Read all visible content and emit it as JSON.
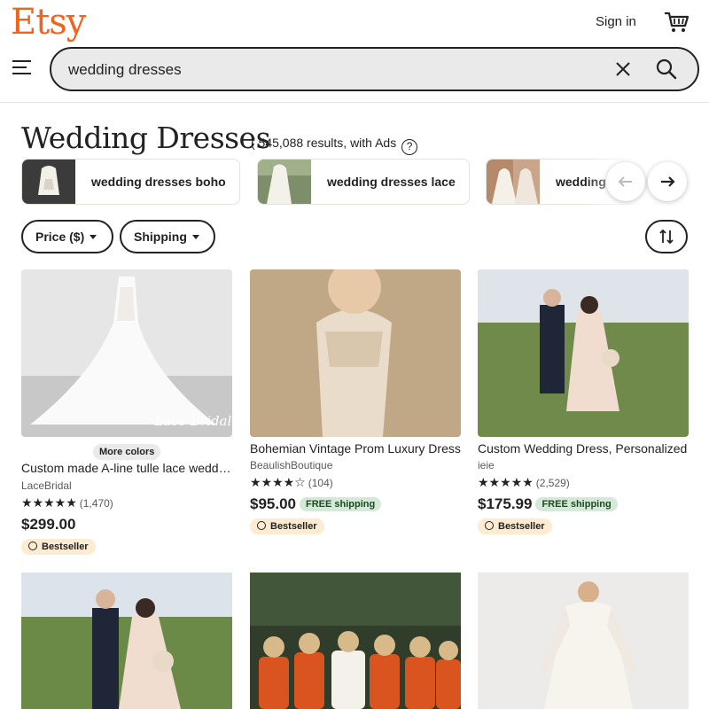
{
  "header": {
    "logo": "Etsy",
    "signin_label": "Sign in",
    "search_value": "wedding dresses",
    "brand_color": "#f1641e"
  },
  "page": {
    "title": "Wedding Dresses",
    "results_text": "( 545,088 results,",
    "ads_text": "with Ads"
  },
  "related": [
    {
      "label": "wedding dresses boho"
    },
    {
      "label": "wedding dresses lace"
    },
    {
      "label": "wedding"
    }
  ],
  "filters": {
    "price_label": "Price ($)",
    "shipping_label": "Shipping"
  },
  "listings": [
    {
      "title": "Custom made A-line tulle lace wedding dress",
      "shop": "LaceBridal",
      "stars": "★★★★★",
      "reviews": "(1,470)",
      "price": "$299.00",
      "badge": "Bestseller",
      "more_colors": "More colors",
      "free_shipping": ""
    },
    {
      "title": "Bohemian Vintage Prom Luxury Dress",
      "shop": "BeaulishBoutique",
      "stars": "★★★★☆",
      "reviews": "(104)",
      "price": "$95.00",
      "badge": "Bestseller",
      "more_colors": "",
      "free_shipping": "FREE shipping"
    },
    {
      "title": "Custom Wedding Dress, Personalized",
      "shop": "ieie",
      "stars": "★★★★★",
      "reviews": "(2,529)",
      "price": "$175.99",
      "badge": "Bestseller",
      "more_colors": "",
      "free_shipping": "FREE shipping"
    }
  ],
  "image_watermark": "Lace Bridal"
}
